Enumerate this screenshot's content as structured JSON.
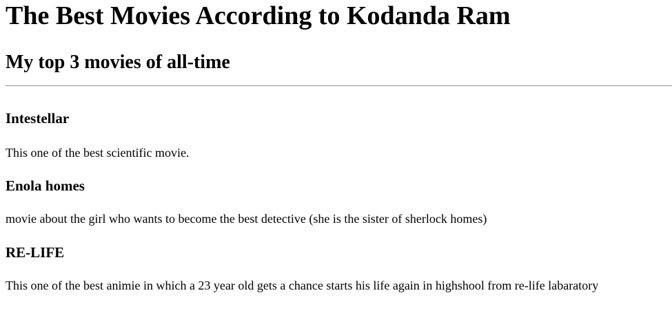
{
  "page": {
    "title": "The Best Movies According to Kodanda Ram",
    "subtitle": "My top 3 movies of all-time"
  },
  "movies": [
    {
      "title": "Intestellar",
      "description": "This one of the best scientific movie."
    },
    {
      "title": "Enola homes",
      "description": "movie about the girl who wants to become the best detective (she is the sister of sherlock homes)"
    },
    {
      "title": "RE-LIFE",
      "description": "This one of the best animie in which a 23 year old gets a chance starts his life again in highshool from re-life labaratory"
    }
  ]
}
